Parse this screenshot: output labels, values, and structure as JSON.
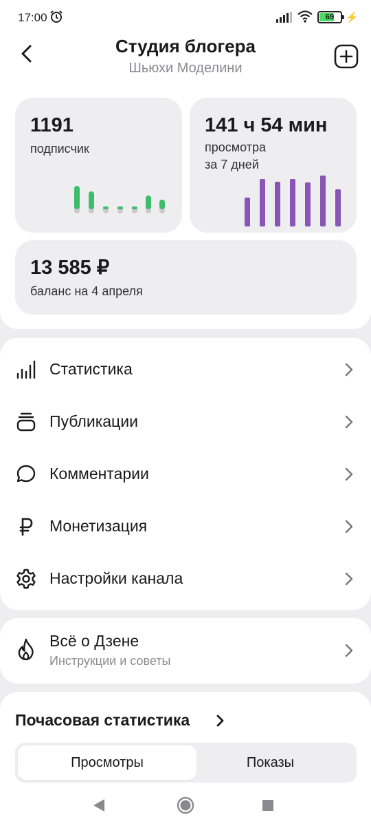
{
  "status_bar": {
    "time": "17:00",
    "battery_level": "69",
    "icons": [
      "alarm-icon",
      "signal-icon",
      "wifi-icon",
      "battery-icon",
      "charging-icon"
    ]
  },
  "header": {
    "title": "Студия блогера",
    "subtitle": "Шьюхи Моделини",
    "back_icon": "back-arrow-icon",
    "add_icon": "plus-square-icon"
  },
  "stats": {
    "subscribers": {
      "value": "1191",
      "label": "подписчик",
      "accent": "#3dbd6b"
    },
    "views": {
      "value": "141 ч 54 мин",
      "label_line1": "просмотра",
      "label_line2": "за 7 дней",
      "accent": "#8a55b6"
    },
    "balance": {
      "value": "13 585 ₽",
      "label": "баланс на 4 апреля"
    }
  },
  "menu": {
    "items": [
      {
        "label": "Статистика",
        "icon": "bar-chart-icon"
      },
      {
        "label": "Публикации",
        "icon": "stack-icon"
      },
      {
        "label": "Комментарии",
        "icon": "comment-bubble-icon"
      },
      {
        "label": "Монетизация",
        "icon": "ruble-icon"
      },
      {
        "label": "Настройки канала",
        "icon": "gear-icon"
      }
    ]
  },
  "zen": {
    "title": "Всё о Дзене",
    "subtitle": "Инструкции и советы",
    "icon": "flame-icon"
  },
  "hourly": {
    "title": "Почасовая статистика",
    "tabs": [
      "Просмотры",
      "Показы"
    ],
    "active_tab": "Просмотры"
  },
  "navbar": {
    "icons": [
      "back-triangle-icon",
      "home-circle-icon",
      "recents-square-icon"
    ]
  }
}
